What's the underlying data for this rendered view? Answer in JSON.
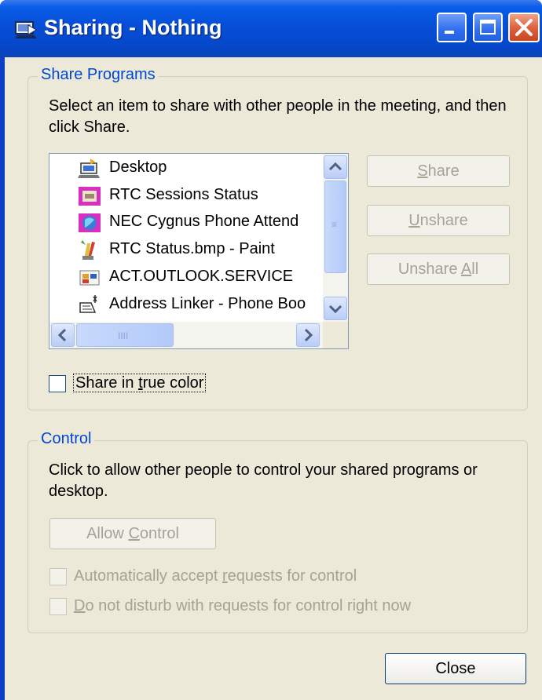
{
  "window": {
    "title": "Sharing - Nothing",
    "buttons": [
      "minimize",
      "maximize",
      "close"
    ]
  },
  "share_programs": {
    "legend": "Share Programs",
    "instructions": "Select an item to share with other people in the meeting, and then click Share.",
    "items": [
      {
        "label": "Desktop",
        "icon": "desktop-icon"
      },
      {
        "label": "RTC Sessions Status",
        "icon": "rtc-sessions-icon"
      },
      {
        "label": "NEC Cygnus Phone Attend",
        "icon": "nec-cygnus-icon"
      },
      {
        "label": "RTC Status.bmp - Paint",
        "icon": "paint-icon"
      },
      {
        "label": "ACT.OUTLOOK.SERVICE",
        "icon": "act-outlook-icon"
      },
      {
        "label": "Address Linker - Phone Boo",
        "icon": "address-linker-icon"
      }
    ],
    "scroll_grip": "≡",
    "hscroll_grip": "IIII",
    "share_button": {
      "pre": "",
      "key": "S",
      "post": "hare"
    },
    "unshare_button": {
      "pre": "",
      "key": "U",
      "post": "nshare"
    },
    "unshare_all_button": {
      "pre": "Unshare ",
      "key": "A",
      "post": "ll"
    },
    "true_color": {
      "pre": "Share in ",
      "key": "t",
      "post": "rue color",
      "checked": false
    }
  },
  "control": {
    "legend": "Control",
    "instructions": "Click to allow other people to control your shared programs or desktop.",
    "allow_button": {
      "pre": "Allow ",
      "key": "C",
      "post": "ontrol"
    },
    "auto_accept": {
      "pre": "Automatically accept ",
      "key": "r",
      "post": "equests for control",
      "checked": false
    },
    "do_not_disturb": {
      "pre": "",
      "key": "D",
      "post": "o not disturb with requests for control right now",
      "checked": false
    }
  },
  "close_button": "Close",
  "colors": {
    "title_bar": "#0a5ee8",
    "client_bg": "#ece9d8",
    "group_legend": "#0046d5",
    "disabled_text": "#a5a296"
  }
}
